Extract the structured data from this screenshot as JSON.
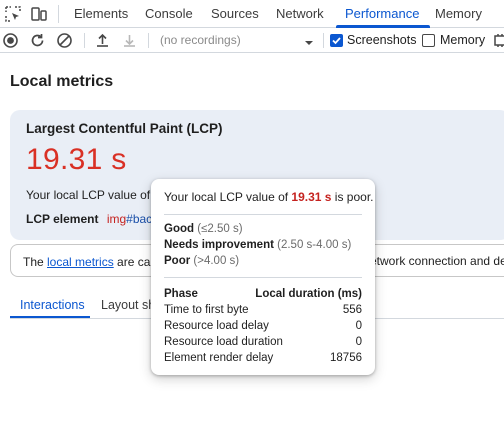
{
  "tabs": [
    {
      "label": "Elements"
    },
    {
      "label": "Console"
    },
    {
      "label": "Sources"
    },
    {
      "label": "Network"
    },
    {
      "label": "Performance"
    },
    {
      "label": "Memory"
    }
  ],
  "active_tab": "Performance",
  "toolbar": {
    "recordings_placeholder": "(no recordings)",
    "screenshots_label": "Screenshots",
    "screenshots_checked": true,
    "memory_label": "Memory",
    "memory_checked": false
  },
  "main": {
    "heading": "Local metrics",
    "lcp_card": {
      "title": "Largest Contentful Paint (LCP)",
      "value": "19.31 s",
      "desc_prefix": "Your local LCP value of 1",
      "lcp_element_label": "LCP element",
      "lcp_element_tag": "img",
      "lcp_element_id": "#back"
    },
    "notice": {
      "prefix": "The ",
      "link": "local metrics",
      "suffix": " are cap",
      "right_text": "etwork connection and de"
    },
    "subtabs": [
      {
        "label": "Interactions"
      },
      {
        "label": "Layout sh"
      }
    ]
  },
  "tooltip": {
    "line_prefix": "Your local LCP value of ",
    "line_value": "19.31 s",
    "line_suffix": " is poor.",
    "good_label": "Good",
    "good_range": "(≤2.50 s)",
    "needs_label": "Needs improvement",
    "needs_range": "(2.50 s-4.00 s)",
    "poor_label": "Poor",
    "poor_range": "(>4.00 s)",
    "table_head_phase": "Phase",
    "table_head_duration": "Local duration (ms)",
    "rows": [
      {
        "phase": "Time to first byte",
        "duration": "556"
      },
      {
        "phase": "Resource load delay",
        "duration": "0"
      },
      {
        "phase": "Resource load duration",
        "duration": "0"
      },
      {
        "phase": "Element render delay",
        "duration": "18756"
      }
    ]
  },
  "colors": {
    "accent": "#0b57d0",
    "poor": "#d93025",
    "card_bg": "#e9eef6"
  }
}
